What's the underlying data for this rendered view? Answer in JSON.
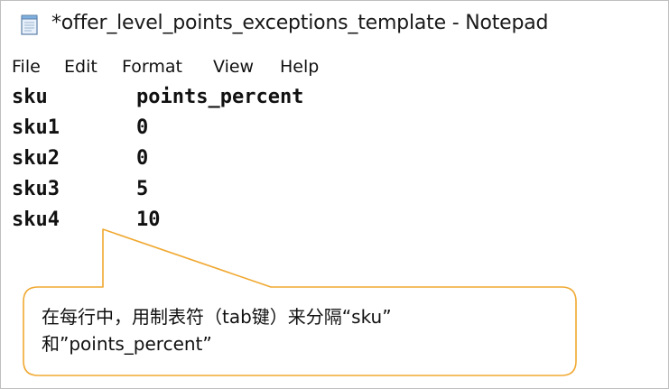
{
  "window": {
    "title": "*offer_level_points_exceptions_template - Notepad",
    "app_icon": "notepad-icon"
  },
  "menu": {
    "items": [
      "File",
      "Edit",
      "Format",
      "View",
      "Help"
    ]
  },
  "editor": {
    "rows": [
      [
        "sku",
        "points_percent"
      ],
      [
        "sku1",
        "0"
      ],
      [
        "sku2",
        "0"
      ],
      [
        "sku3",
        "5"
      ],
      [
        "sku4",
        "10"
      ]
    ]
  },
  "callout": {
    "line1": "在每行中，用制表符（tab键）来分隔“sku”",
    "line2": "和”points_percent”",
    "border_color": "#f0a830",
    "fill_color": "#ffffff"
  }
}
